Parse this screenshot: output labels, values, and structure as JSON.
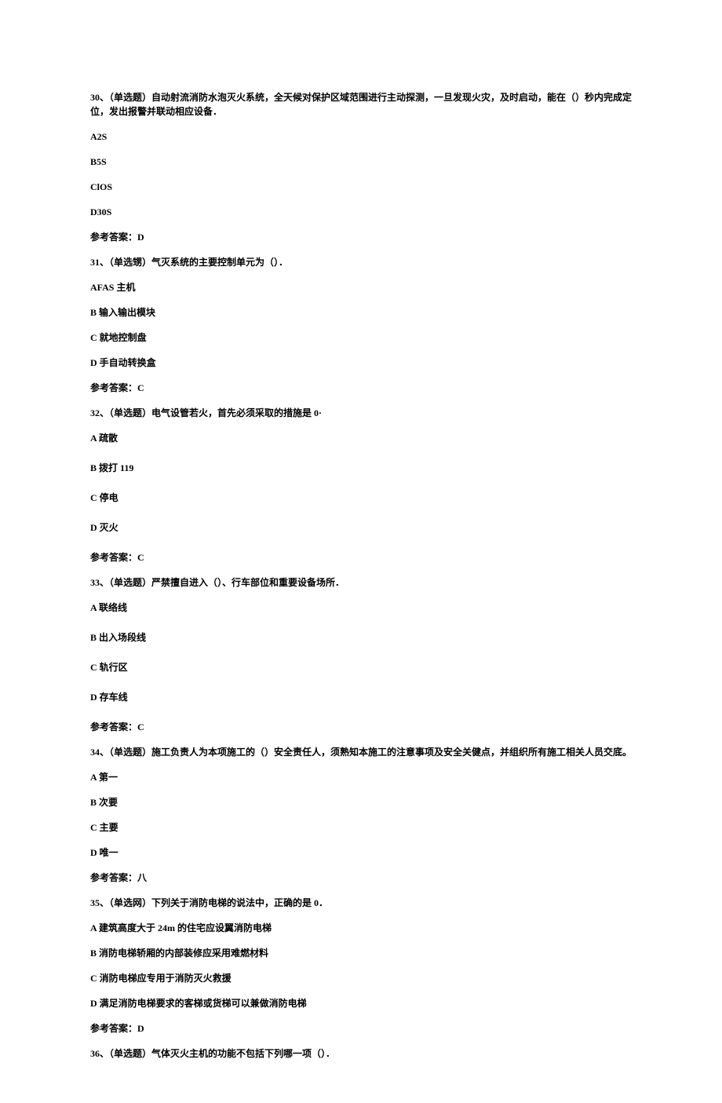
{
  "q30": {
    "text": "30、（单选题）自动射流消防水泡灭火系统，全天候对保护区域范围进行主动探测，一旦发现火灾，及时启动，能在（）秒内完成定位，发出报警并联动相应设备．",
    "A": "A2S",
    "B": "B5S",
    "C": "ClOS",
    "D": "D30S",
    "ans": "参考答案：D"
  },
  "q31": {
    "text": "31、（单选甥）气灭系统的主要控制单元为（）．",
    "A": "AFAS 主机",
    "B": "B 输入输出模块",
    "C": "C 就地控制盘",
    "D": "D 手自动转换盒",
    "ans": "参考答案：C"
  },
  "q32": {
    "text": "32、（单选题）电气设管若火，首先必须采取的措施是 0·",
    "A": "A 疏散",
    "B": "B 拨打 119",
    "C": "C 停电",
    "D": "D 灭火",
    "ans": "参考答案：C"
  },
  "q33": {
    "text": "33、（单选题）严禁擅自进入（）、行车部位和重要设备场所．",
    "A": "A 联络线",
    "B": "B 出入场段线",
    "C": "C 轨行区",
    "D": "D 存车线",
    "ans": "参考答案：C"
  },
  "q34": {
    "text": "34、（单选题）施工负责人为本项施工的（）安全责任人，须熟知本施工的注意事项及安全关健点，并组织所有施工相关人员交底。",
    "A": "A 第一",
    "B": "B 次要",
    "C": "C 主要",
    "D": "D 唯一",
    "ans": "参考答案：八"
  },
  "q35": {
    "text": "35、（单选网）下列关于消防电梯的说法中，正确的是 0．",
    "A": "A 建筑高度大于 24m 的住宅应设翼消防电梯",
    "B": "B 消防电梯轿厢的内部装修应采用难燃材料",
    "C": "C 消防电梯应专用于消防灭火救援",
    "D": "D 满足消防电梯要求的客梯或货梯可以兼做消防电梯",
    "ans": "参考答案：D"
  },
  "q36": {
    "text": "36、（单选题）气体灭火主机的功能不包括下列哪一项（）．"
  }
}
